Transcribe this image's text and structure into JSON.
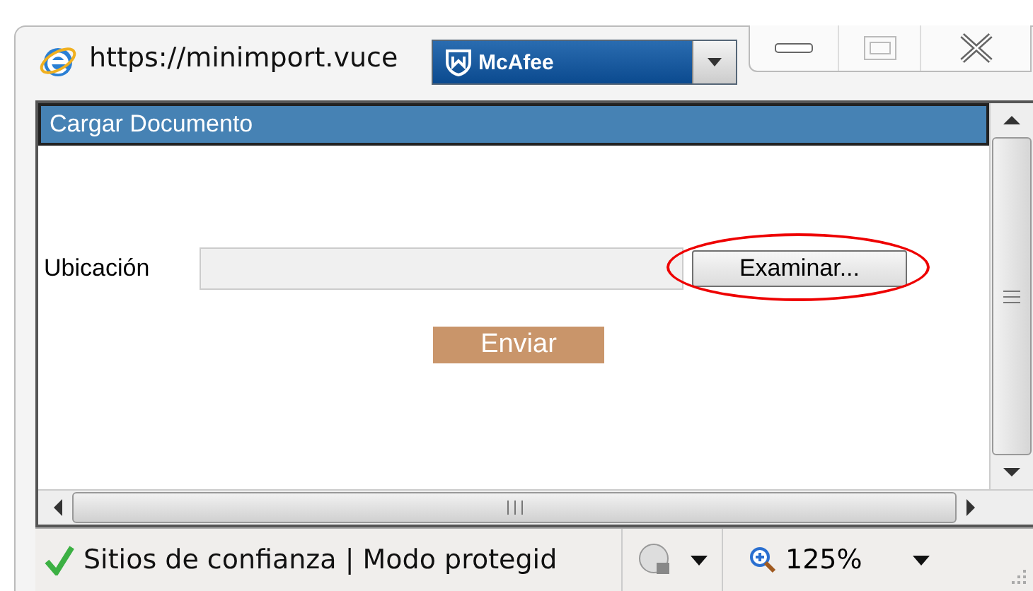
{
  "window": {
    "address": "https://minimport.vuce",
    "toolbar": {
      "label": "McAfee"
    }
  },
  "page": {
    "header": "Cargar Documento",
    "field_label": "Ubicación",
    "browse_button": {
      "label": "Examinar...",
      "highlighted": true
    },
    "submit_button": "Enviar"
  },
  "status_bar": {
    "zone": "Sitios de confianza | Modo protegid",
    "zoom": "125%"
  }
}
